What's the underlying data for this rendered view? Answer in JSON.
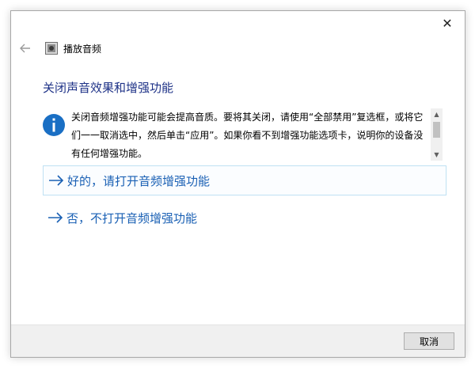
{
  "window": {
    "close_glyph": "✕",
    "app_title": "播放音频",
    "back_icon": "back-arrow-icon",
    "app_icon": "speaker-troubleshooter-icon"
  },
  "heading": "关闭声音效果和增强功能",
  "info": {
    "icon": "info-icon",
    "text": "关闭音频增强功能可能会提高音质。要将其关闭，请使用“全部禁用”复选框，或将它们一一取消选中，然后单击“应用”。如果你看不到增强功能选项卡，说明你的设备没有任何增强功能。"
  },
  "options": [
    {
      "label": "好的，请打开音频增强功能",
      "icon": "right-arrow-icon"
    },
    {
      "label": "否，不打开音频增强功能",
      "icon": "right-arrow-icon"
    }
  ],
  "footer": {
    "cancel_label": "取消"
  },
  "colors": {
    "heading": "#1e3287",
    "option_text": "#1a60b4",
    "info_icon": "#1a6fc4",
    "highlight_border": "#bfe1f3"
  }
}
